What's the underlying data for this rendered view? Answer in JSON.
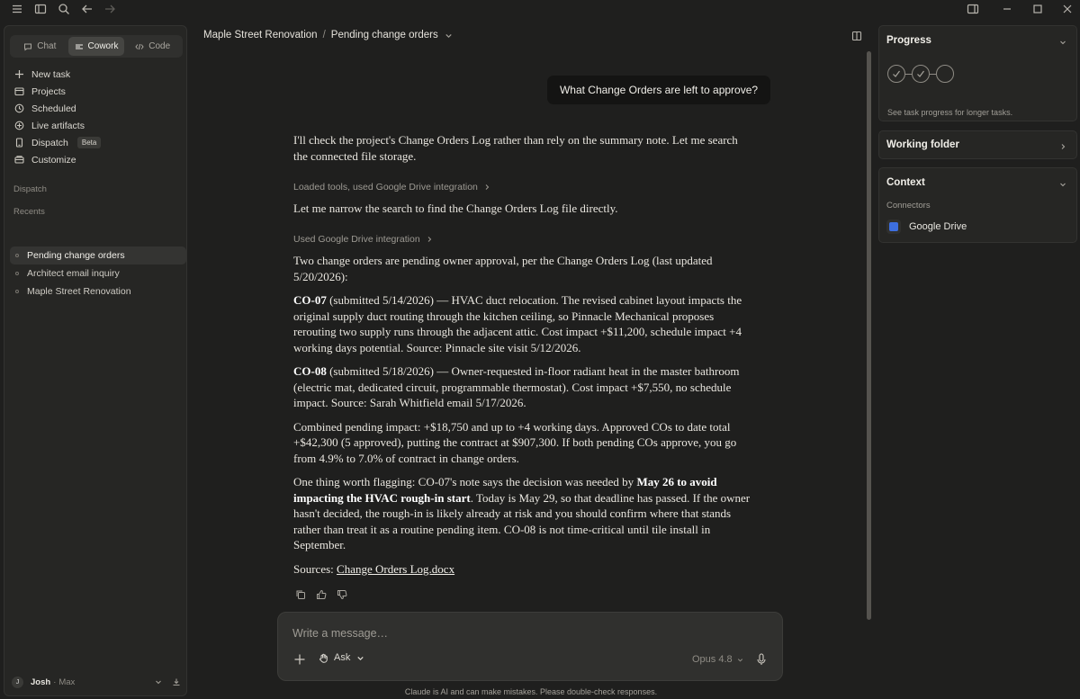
{
  "titlebar": {
    "icons": [
      "menu-icon",
      "sidebar-toggle-icon",
      "search-icon",
      "back-icon",
      "forward-icon"
    ],
    "window_icons": [
      "split-view-icon",
      "minimize-icon",
      "maximize-icon",
      "close-icon"
    ]
  },
  "sidebar": {
    "modes": [
      {
        "label": "Chat",
        "active": false
      },
      {
        "label": "Cowork",
        "active": true
      },
      {
        "label": "Code",
        "active": false
      }
    ],
    "nav": [
      {
        "label": "New task",
        "icon": "plus-icon"
      },
      {
        "label": "Projects",
        "icon": "projects-icon"
      },
      {
        "label": "Scheduled",
        "icon": "clock-icon"
      },
      {
        "label": "Live artifacts",
        "icon": "artifacts-icon"
      },
      {
        "label": "Dispatch",
        "icon": "phone-icon",
        "badge": "Beta"
      },
      {
        "label": "Customize",
        "icon": "customize-icon"
      }
    ],
    "dispatch_title": "Dispatch",
    "recents_title": "Recents",
    "recents": [
      {
        "label": "Pending change orders",
        "active": true
      },
      {
        "label": "Architect email inquiry",
        "active": false
      },
      {
        "label": "Maple Street Renovation",
        "active": false
      }
    ],
    "user": {
      "initial": "J",
      "name": "Josh",
      "plan": "Max"
    }
  },
  "main": {
    "breadcrumb": {
      "project": "Maple Street Renovation",
      "separator": "/",
      "task": "Pending change orders"
    },
    "user_message": "What Change Orders are left to approve?",
    "intro": "I'll check the project's Change Orders Log rather than rely on the summary note. Let me search the connected file storage.",
    "tool1": "Loaded tools, used Google Drive integration",
    "narrow": "Let me narrow the search to find the Change Orders Log file directly.",
    "tool2": "Used Google Drive integration",
    "summary": "Two change orders are pending owner approval, per the Change Orders Log (last updated 5/20/2026):",
    "co07": {
      "id": "CO-07",
      "text": " (submitted 5/14/2026) — HVAC duct relocation. The revised cabinet layout impacts the original supply duct routing through the kitchen ceiling, so Pinnacle Mechanical proposes rerouting two supply runs through the adjacent attic. Cost impact +$11,200, schedule impact +4 working days potential. Source: Pinnacle site visit 5/12/2026."
    },
    "co08": {
      "id": "CO-08",
      "text": " (submitted 5/18/2026) — Owner-requested in-floor radiant heat in the master bathroom (electric mat, dedicated circuit, programmable thermostat). Cost impact +$7,550, no schedule impact. Source: Sarah Whitfield email 5/17/2026."
    },
    "combined": "Combined pending impact: +$18,750 and up to +4 working days. Approved COs to date total +$42,300 (5 approved), putting the contract at $907,300. If both pending COs approve, you go from 4.9% to 7.0% of contract in change orders.",
    "flag": {
      "before": "One thing worth flagging: CO-07's note says the decision was needed by ",
      "bold": "May 26 to avoid impacting the HVAC rough-in start",
      "after": ". Today is May 29, so that deadline has passed. If the owner hasn't decided, the rough-in is likely already at risk and you should confirm where that stands rather than treat it as a routine pending item. CO-08 is not time-critical until tile install in September."
    },
    "sources_label": "Sources: ",
    "sources_link": "Change Orders Log.docx",
    "composer": {
      "placeholder": "Write a message…",
      "mode": "Ask",
      "model": "Opus 4.8"
    },
    "disclaimer": "Claude is AI and can make mistakes. Please double-check responses."
  },
  "rightpanel": {
    "progress": {
      "title": "Progress",
      "steps_done": 2,
      "steps_total": 3,
      "note": "See task progress for longer tasks."
    },
    "working_folder": {
      "title": "Working folder"
    },
    "context": {
      "title": "Context",
      "connectors_label": "Connectors",
      "connector": "Google Drive"
    }
  }
}
